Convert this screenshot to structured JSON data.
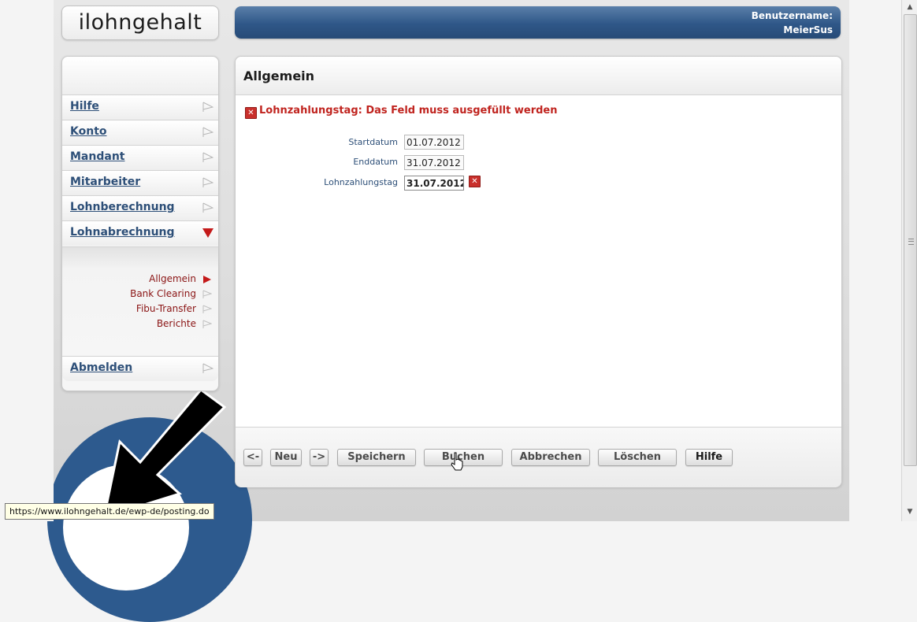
{
  "logo": {
    "text": "ilohngehalt"
  },
  "header": {
    "user_label": "Benutzername:",
    "user_name": "MeierSus"
  },
  "sidebar": {
    "items": [
      {
        "label": "Hilfe"
      },
      {
        "label": "Konto"
      },
      {
        "label": "Mandant"
      },
      {
        "label": "Mitarbeiter"
      },
      {
        "label": "Lohnberechnung"
      },
      {
        "label": "Lohnabrechnung"
      },
      {
        "label": "Abmelden"
      }
    ],
    "sub_items": [
      {
        "label": "Allgemein"
      },
      {
        "label": "Bank Clearing"
      },
      {
        "label": "Fibu-Transfer"
      },
      {
        "label": "Berichte"
      }
    ]
  },
  "main": {
    "title": "Allgemein",
    "error_message": "Lohnzahlungstag: Das Feld muss ausgefüllt werden",
    "fields": [
      {
        "label": "Startdatum",
        "value": "01.07.2012"
      },
      {
        "label": "Enddatum",
        "value": "31.07.2012"
      },
      {
        "label": "Lohnzahlungstag",
        "value": "31.07.2012"
      }
    ]
  },
  "buttons": {
    "prev": "<-",
    "new": "Neu",
    "next": "->",
    "save": "Speichern",
    "post": "Buchen",
    "cancel": "Abbrechen",
    "delete": "Löschen",
    "help": "Hilfe"
  },
  "status_bar": {
    "url": "https://www.ilohngehalt.de/ewp-de/posting.do"
  },
  "colors": {
    "header_blue": "#2f5788",
    "nav_link": "#2d4f78",
    "sub_link": "#8a1414",
    "error_red": "#c0241f",
    "active_arrow": "#c41a1a"
  }
}
